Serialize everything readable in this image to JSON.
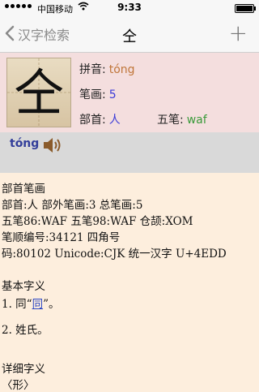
{
  "status": {
    "carrier": "中国移动",
    "time": "9:33",
    "battery_level": 0.9
  },
  "nav": {
    "back_label": "汉字检索",
    "title": "仝",
    "add_label": "+"
  },
  "character": {
    "glyph": "仝",
    "pinyin_label": "拼音:",
    "pinyin_value": "tóng",
    "strokes_label": "笔画:",
    "strokes_value": "5",
    "radical_label": "部首:",
    "radical_value": "人",
    "wubi_label": "五笔:",
    "wubi_value": "waf",
    "colors": {
      "pinyin": "#c0763a",
      "strokes": "#3b3bd8",
      "radical": "#3b3bd8",
      "wubi": "#3a9a3a"
    }
  },
  "pronunciation": {
    "pinyin": "tóng",
    "speaker_icon": "speaker-icon"
  },
  "details": {
    "radical_heading": "部首笔画",
    "line1": "部首:人  部外笔画:3  总笔画:5",
    "line2": "五笔86:WAF  五笔98:WAF  仓颉:XOM",
    "line3": "笔顺编号:34121   四角号",
    "line4": "码:80102  Unicode:CJK 统一汉字 U+4EDD",
    "basic_heading": "基本字义",
    "basic1_prefix": "1. 同“",
    "basic1_link": "同",
    "basic1_suffix": "”。",
    "basic2": "2. 姓氏。",
    "detail_heading": "详细字义",
    "detail_pos": "〈形〉"
  }
}
